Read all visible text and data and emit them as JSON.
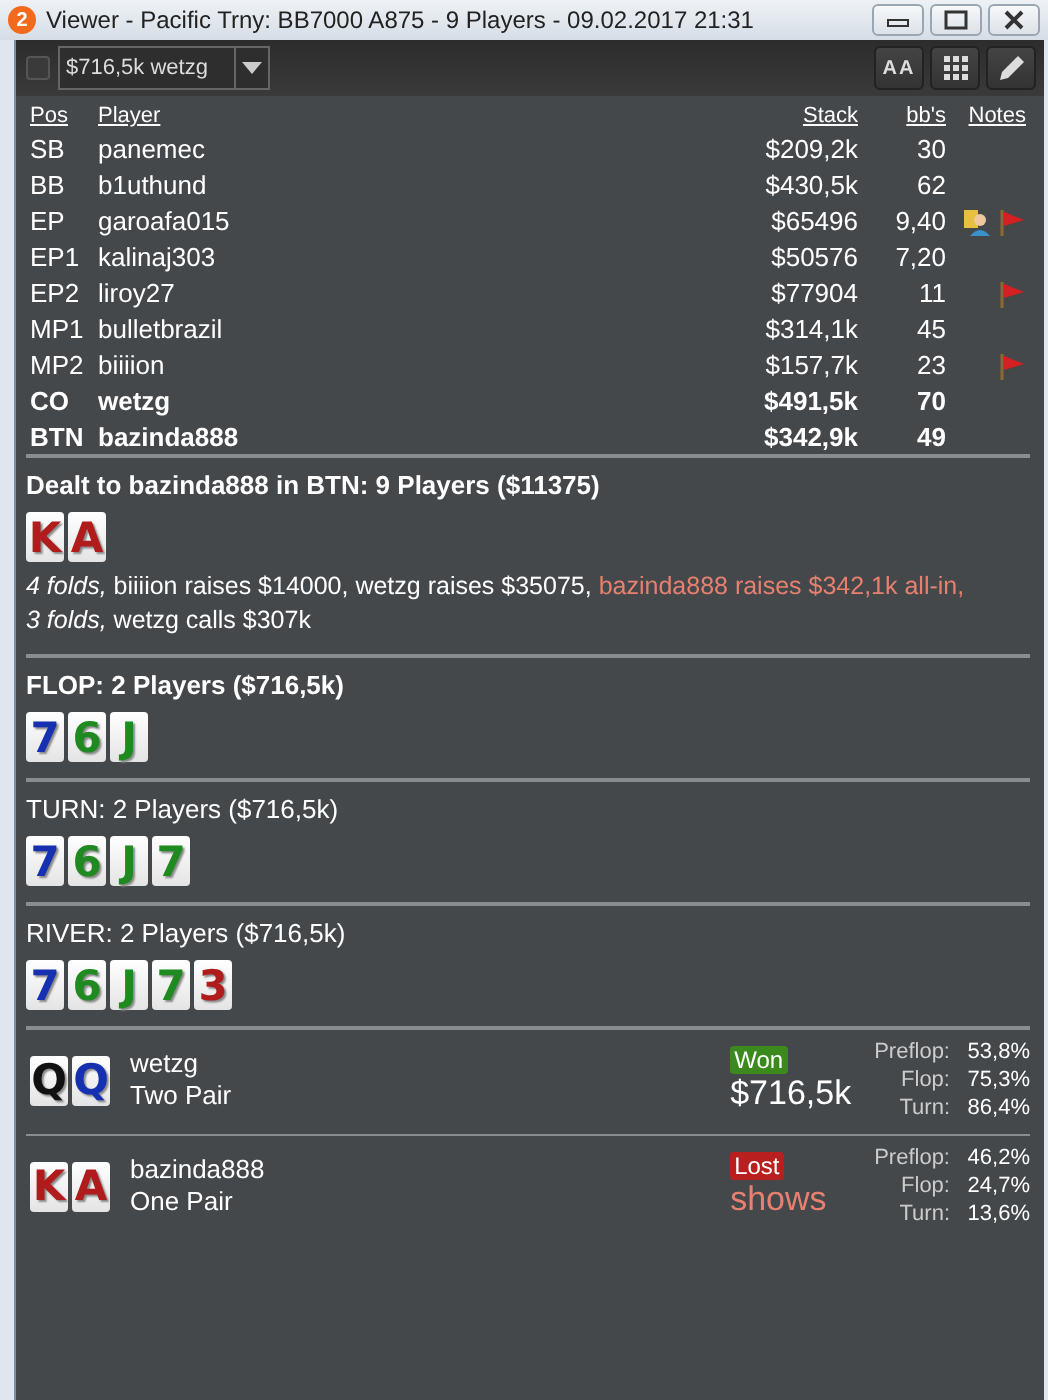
{
  "window": {
    "title": "Viewer - Pacific Trny: BB7000 A875 - 9 Players - 09.02.2017 21:31",
    "badge": "2"
  },
  "toolbar": {
    "checked": false,
    "hand_select": "$716,5k wetzg",
    "font_button": "AA"
  },
  "table": {
    "columns": [
      "Pos",
      "Player",
      "Stack",
      "bb's",
      "Notes"
    ],
    "rows": [
      {
        "pos": "SB",
        "player": "panemec",
        "stack": "$209,2k",
        "bbs": "30",
        "hero": false,
        "notes": []
      },
      {
        "pos": "BB",
        "player": "b1uthund",
        "stack": "$430,5k",
        "bbs": "62",
        "hero": false,
        "notes": []
      },
      {
        "pos": "EP",
        "player": "garoafa015",
        "stack": "$65496",
        "bbs": "9,40",
        "hero": false,
        "notes": [
          {
            "kind": "person"
          },
          {
            "kind": "flag"
          }
        ]
      },
      {
        "pos": "EP1",
        "player": "kalinaj303",
        "stack": "$50576",
        "bbs": "7,20",
        "hero": false,
        "notes": []
      },
      {
        "pos": "EP2",
        "player": "liroy27",
        "stack": "$77904",
        "bbs": "11",
        "hero": false,
        "notes": [
          {
            "kind": "flag"
          }
        ]
      },
      {
        "pos": "MP1",
        "player": "bulletbrazil",
        "stack": "$314,1k",
        "bbs": "45",
        "hero": false,
        "notes": []
      },
      {
        "pos": "MP2",
        "player": "biiiion",
        "stack": "$157,7k",
        "bbs": "23",
        "hero": false,
        "notes": [
          {
            "kind": "flag"
          }
        ]
      },
      {
        "pos": "CO",
        "player": "wetzg",
        "stack": "$491,5k",
        "bbs": "70",
        "hero": true,
        "notes": []
      },
      {
        "pos": "BTN",
        "player": "bazinda888",
        "stack": "$342,9k",
        "bbs": "49",
        "hero": true,
        "notes": []
      }
    ]
  },
  "streets": [
    {
      "title": "Dealt to bazinda888 in BTN: 9 Players ($11375)",
      "bold": true,
      "cards": [
        {
          "rank": "K",
          "color": "#b01c1c"
        },
        {
          "rank": "A",
          "color": "#b01c1c"
        }
      ],
      "actions": [
        {
          "kind": "fold",
          "text": "4 folds,"
        },
        {
          "kind": "plain",
          "text": "biiiion raises $14000, wetzg raises $35075,"
        },
        {
          "kind": "hero",
          "text": "bazinda888 raises $342,1k all-in,"
        },
        {
          "kind": "fold",
          "text": "3 folds,"
        },
        {
          "kind": "plain",
          "text": "wetzg calls $307k"
        }
      ]
    },
    {
      "title": "FLOP: 2 Players ($716,5k)",
      "bold": true,
      "cards": [
        {
          "rank": "7",
          "color": "#1530b0"
        },
        {
          "rank": "6",
          "color": "#1f8a1f"
        },
        {
          "rank": "J",
          "color": "#1f8a1f"
        }
      ]
    },
    {
      "title": "TURN: 2 Players ($716,5k)",
      "bold": false,
      "cards": [
        {
          "rank": "7",
          "color": "#1530b0"
        },
        {
          "rank": "6",
          "color": "#1f8a1f"
        },
        {
          "rank": "J",
          "color": "#1f8a1f"
        },
        {
          "rank": "7",
          "color": "#1f8a1f"
        }
      ]
    },
    {
      "title": "RIVER: 2 Players ($716,5k)",
      "bold": false,
      "cards": [
        {
          "rank": "7",
          "color": "#1530b0"
        },
        {
          "rank": "6",
          "color": "#1f8a1f"
        },
        {
          "rank": "J",
          "color": "#1f8a1f"
        },
        {
          "rank": "7",
          "color": "#1f8a1f"
        },
        {
          "rank": "3",
          "color": "#b01c1c"
        }
      ]
    }
  ],
  "results": [
    {
      "cards": [
        {
          "rank": "Q",
          "color": "#111111"
        },
        {
          "rank": "Q",
          "color": "#1530b0"
        }
      ],
      "player": "wetzg",
      "hand": "Two Pair",
      "kind": "won",
      "badge": "Won",
      "amount": "$716,5k",
      "equity": [
        {
          "label": "Preflop:",
          "value": "53,8%"
        },
        {
          "label": "Flop:",
          "value": "75,3%"
        },
        {
          "label": "Turn:",
          "value": "86,4%"
        }
      ]
    },
    {
      "cards": [
        {
          "rank": "K",
          "color": "#b01c1c"
        },
        {
          "rank": "A",
          "color": "#b01c1c"
        }
      ],
      "player": "bazinda888",
      "hand": "One Pair",
      "kind": "lost",
      "badge": "Lost",
      "amount": "shows",
      "equity": [
        {
          "label": "Preflop:",
          "value": "46,2%"
        },
        {
          "label": "Flop:",
          "value": "24,7%"
        },
        {
          "label": "Turn:",
          "value": "13,6%"
        }
      ]
    }
  ]
}
